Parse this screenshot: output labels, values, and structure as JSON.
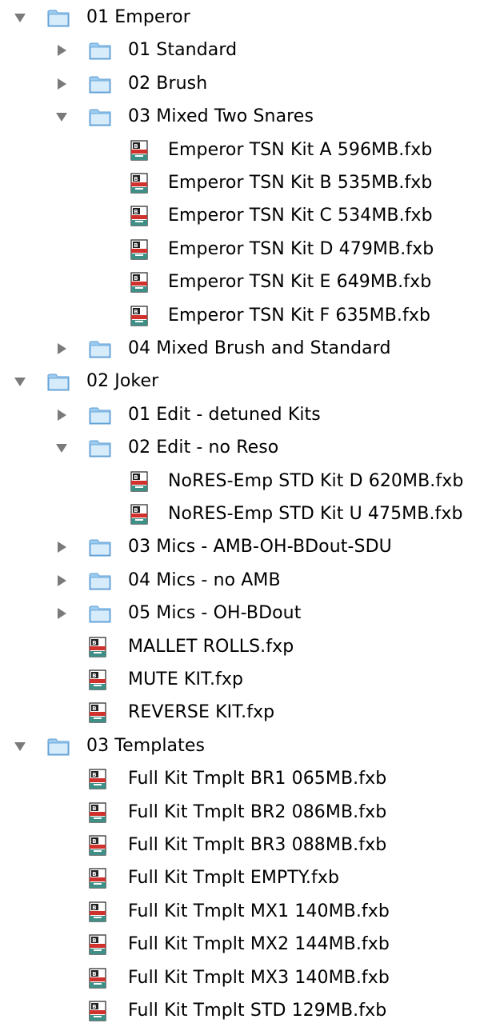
{
  "tree": [
    {
      "type": "folder",
      "label": "01 Emperor",
      "expanded": true,
      "children": [
        {
          "type": "folder",
          "label": "01 Standard",
          "expanded": false
        },
        {
          "type": "folder",
          "label": "02 Brush",
          "expanded": false
        },
        {
          "type": "folder",
          "label": "03 Mixed Two Snares",
          "expanded": true,
          "children": [
            {
              "type": "file",
              "label": "Emperor TSN Kit A 596MB.fxb",
              "icon": "fxb-file-icon"
            },
            {
              "type": "file",
              "label": "Emperor TSN Kit B 535MB.fxb",
              "icon": "fxb-file-icon"
            },
            {
              "type": "file",
              "label": "Emperor TSN Kit C 534MB.fxb",
              "icon": "fxb-file-icon"
            },
            {
              "type": "file",
              "label": "Emperor TSN Kit D 479MB.fxb",
              "icon": "fxb-file-icon"
            },
            {
              "type": "file",
              "label": "Emperor TSN Kit E 649MB.fxb",
              "icon": "fxb-file-icon"
            },
            {
              "type": "file",
              "label": "Emperor TSN Kit F 635MB.fxb",
              "icon": "fxb-file-icon"
            }
          ]
        },
        {
          "type": "folder",
          "label": "04 Mixed Brush and Standard",
          "expanded": false
        }
      ]
    },
    {
      "type": "folder",
      "label": "02 Joker",
      "expanded": true,
      "children": [
        {
          "type": "folder",
          "label": "01 Edit - detuned Kits",
          "expanded": false
        },
        {
          "type": "folder",
          "label": "02 Edit - no Reso",
          "expanded": true,
          "children": [
            {
              "type": "file",
              "label": "NoRES-Emp STD Kit D 620MB.fxb",
              "icon": "fxb-file-icon"
            },
            {
              "type": "file",
              "label": "NoRES-Emp STD Kit U 475MB.fxb",
              "icon": "fxb-file-icon"
            }
          ]
        },
        {
          "type": "folder",
          "label": "03 Mics - AMB-OH-BDout-SDU",
          "expanded": false
        },
        {
          "type": "folder",
          "label": "04 Mics - no AMB",
          "expanded": false
        },
        {
          "type": "folder",
          "label": "05 Mics - OH-BDout",
          "expanded": false
        },
        {
          "type": "file",
          "label": "MALLET ROLLS.fxp",
          "icon": "fxp-file-icon"
        },
        {
          "type": "file",
          "label": "MUTE KIT.fxp",
          "icon": "fxp-file-icon"
        },
        {
          "type": "file",
          "label": "REVERSE KIT.fxp",
          "icon": "fxp-file-icon"
        }
      ]
    },
    {
      "type": "folder",
      "label": "03 Templates",
      "expanded": true,
      "children": [
        {
          "type": "file",
          "label": "Full Kit Tmplt BR1 065MB.fxb",
          "icon": "fxb-file-icon"
        },
        {
          "type": "file",
          "label": "Full Kit Tmplt BR2 086MB.fxb",
          "icon": "fxb-file-icon"
        },
        {
          "type": "file",
          "label": "Full Kit Tmplt BR3 088MB.fxb",
          "icon": "fxb-file-icon"
        },
        {
          "type": "file",
          "label": "Full Kit Tmplt EMPTY.fxb",
          "icon": "fxb-file-icon"
        },
        {
          "type": "file",
          "label": "Full Kit Tmplt MX1 140MB.fxb",
          "icon": "fxb-file-icon"
        },
        {
          "type": "file",
          "label": "Full Kit Tmplt MX2 144MB.fxb",
          "icon": "fxb-file-icon"
        },
        {
          "type": "file",
          "label": "Full Kit Tmplt MX3 140MB.fxb",
          "icon": "fxb-file-icon"
        },
        {
          "type": "file",
          "label": "Full Kit Tmplt STD 129MB.fxb",
          "icon": "fxb-file-icon"
        }
      ]
    }
  ],
  "colors": {
    "triangle": "#7a7a7a",
    "folder_light": "#d6ecfb",
    "folder_mid": "#9ccbee",
    "folder_edge": "#5c9ed6",
    "file_red": "#d0312d",
    "file_teal": "#3e8f86"
  }
}
